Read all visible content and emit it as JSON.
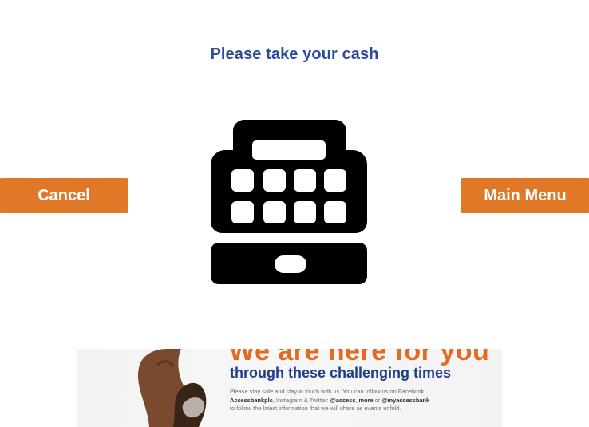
{
  "screen": {
    "title": "Please take your cash"
  },
  "buttons": {
    "cancel_label": "Cancel",
    "main_menu_label": "Main Menu"
  },
  "icon": {
    "name": "cash-register-icon",
    "color": "#000000"
  },
  "banner": {
    "headline": "We are here for you",
    "subheadline": "through these challenging times",
    "body_intro": "Please stay safe and stay in touch with us. You can follow us on Facebook:",
    "facebook_handle": "Accessbankplc",
    "body_mid": ", Instagram & Twitter: ",
    "handle_1": "@access_more",
    "body_or": " or ",
    "handle_2": "@myaccessbank",
    "body_end": "to follow the latest information that we will share as events unfold.",
    "headline_color": "#e36a1e",
    "subheadline_color": "#1f3e8a"
  },
  "colors": {
    "title": "#2b4c9c",
    "button_bg": "#e07828",
    "button_text": "#ffffff"
  }
}
